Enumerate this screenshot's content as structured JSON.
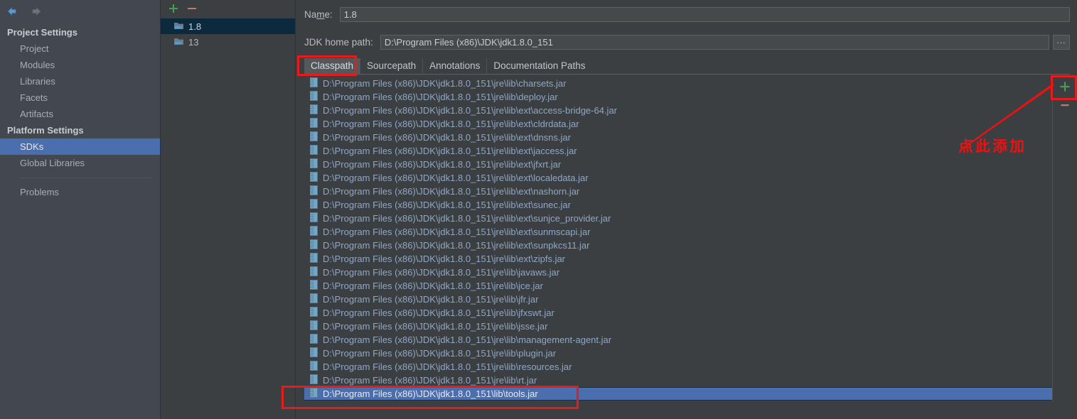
{
  "sidebar": {
    "nav": {
      "back_icon": "arrow-left-icon",
      "forward_icon": "arrow-right-icon"
    },
    "groups": [
      {
        "label": "Project Settings",
        "items": [
          {
            "label": "Project",
            "selected": false
          },
          {
            "label": "Modules",
            "selected": false
          },
          {
            "label": "Libraries",
            "selected": false
          },
          {
            "label": "Facets",
            "selected": false
          },
          {
            "label": "Artifacts",
            "selected": false
          }
        ]
      },
      {
        "label": "Platform Settings",
        "items": [
          {
            "label": "SDKs",
            "selected": true
          },
          {
            "label": "Global Libraries",
            "selected": false
          }
        ]
      }
    ],
    "footer_items": [
      {
        "label": "Problems",
        "selected": false
      }
    ]
  },
  "sdk_panel": {
    "toolbar": {
      "add_label": "+",
      "remove_label": "−"
    },
    "items": [
      {
        "label": "1.8",
        "selected": true,
        "icon": "jdk-folder-icon"
      },
      {
        "label": "13",
        "selected": false,
        "icon": "jdk-folder-icon"
      }
    ]
  },
  "main": {
    "name_field": {
      "label": "Name:",
      "label_prefix": "Na",
      "label_accel": "m",
      "label_suffix": "e:",
      "value": "1.8",
      "placeholder": ""
    },
    "home_path_field": {
      "label": "JDK home path:",
      "value": "D:\\Program Files (x86)\\JDK\\jdk1.8.0_151",
      "placeholder": "",
      "browse_label": "..."
    },
    "tabs": [
      {
        "label": "Classpath",
        "active": true
      },
      {
        "label": "Sourcepath",
        "active": false
      },
      {
        "label": "Annotations",
        "active": false
      },
      {
        "label": "Documentation Paths",
        "active": false
      }
    ],
    "classpath_side_buttons": {
      "add_label": "+",
      "remove_label": "−"
    },
    "classpath_entries": [
      {
        "path": "D:\\Program Files (x86)\\JDK\\jdk1.8.0_151\\jre\\lib\\charsets.jar",
        "selected": false
      },
      {
        "path": "D:\\Program Files (x86)\\JDK\\jdk1.8.0_151\\jre\\lib\\deploy.jar",
        "selected": false
      },
      {
        "path": "D:\\Program Files (x86)\\JDK\\jdk1.8.0_151\\jre\\lib\\ext\\access-bridge-64.jar",
        "selected": false
      },
      {
        "path": "D:\\Program Files (x86)\\JDK\\jdk1.8.0_151\\jre\\lib\\ext\\cldrdata.jar",
        "selected": false
      },
      {
        "path": "D:\\Program Files (x86)\\JDK\\jdk1.8.0_151\\jre\\lib\\ext\\dnsns.jar",
        "selected": false
      },
      {
        "path": "D:\\Program Files (x86)\\JDK\\jdk1.8.0_151\\jre\\lib\\ext\\jaccess.jar",
        "selected": false
      },
      {
        "path": "D:\\Program Files (x86)\\JDK\\jdk1.8.0_151\\jre\\lib\\ext\\jfxrt.jar",
        "selected": false
      },
      {
        "path": "D:\\Program Files (x86)\\JDK\\jdk1.8.0_151\\jre\\lib\\ext\\localedata.jar",
        "selected": false
      },
      {
        "path": "D:\\Program Files (x86)\\JDK\\jdk1.8.0_151\\jre\\lib\\ext\\nashorn.jar",
        "selected": false
      },
      {
        "path": "D:\\Program Files (x86)\\JDK\\jdk1.8.0_151\\jre\\lib\\ext\\sunec.jar",
        "selected": false
      },
      {
        "path": "D:\\Program Files (x86)\\JDK\\jdk1.8.0_151\\jre\\lib\\ext\\sunjce_provider.jar",
        "selected": false
      },
      {
        "path": "D:\\Program Files (x86)\\JDK\\jdk1.8.0_151\\jre\\lib\\ext\\sunmscapi.jar",
        "selected": false
      },
      {
        "path": "D:\\Program Files (x86)\\JDK\\jdk1.8.0_151\\jre\\lib\\ext\\sunpkcs11.jar",
        "selected": false
      },
      {
        "path": "D:\\Program Files (x86)\\JDK\\jdk1.8.0_151\\jre\\lib\\ext\\zipfs.jar",
        "selected": false
      },
      {
        "path": "D:\\Program Files (x86)\\JDK\\jdk1.8.0_151\\jre\\lib\\javaws.jar",
        "selected": false
      },
      {
        "path": "D:\\Program Files (x86)\\JDK\\jdk1.8.0_151\\jre\\lib\\jce.jar",
        "selected": false
      },
      {
        "path": "D:\\Program Files (x86)\\JDK\\jdk1.8.0_151\\jre\\lib\\jfr.jar",
        "selected": false
      },
      {
        "path": "D:\\Program Files (x86)\\JDK\\jdk1.8.0_151\\jre\\lib\\jfxswt.jar",
        "selected": false
      },
      {
        "path": "D:\\Program Files (x86)\\JDK\\jdk1.8.0_151\\jre\\lib\\jsse.jar",
        "selected": false
      },
      {
        "path": "D:\\Program Files (x86)\\JDK\\jdk1.8.0_151\\jre\\lib\\management-agent.jar",
        "selected": false
      },
      {
        "path": "D:\\Program Files (x86)\\JDK\\jdk1.8.0_151\\jre\\lib\\plugin.jar",
        "selected": false
      },
      {
        "path": "D:\\Program Files (x86)\\JDK\\jdk1.8.0_151\\jre\\lib\\resources.jar",
        "selected": false
      },
      {
        "path": "D:\\Program Files (x86)\\JDK\\jdk1.8.0_151\\jre\\lib\\rt.jar",
        "selected": false
      },
      {
        "path": "D:\\Program Files (x86)\\JDK\\jdk1.8.0_151\\lib\\tools.jar",
        "selected": true
      }
    ]
  },
  "annotations": {
    "callout_text": "点此添加",
    "color": "#ee1111",
    "boxes": [
      {
        "name": "classpath-tab-highlight"
      },
      {
        "name": "add-button-highlight"
      },
      {
        "name": "selected-entry-highlight"
      }
    ]
  },
  "colors": {
    "panel_bg": "#3c3f41",
    "sidebar_bg": "#434750",
    "selection_blue": "#4b6eaf",
    "sdk_selection": "#0d293e",
    "text": "#bbbbbb",
    "annotation_red": "#ee1111",
    "add_green": "#499c54"
  }
}
